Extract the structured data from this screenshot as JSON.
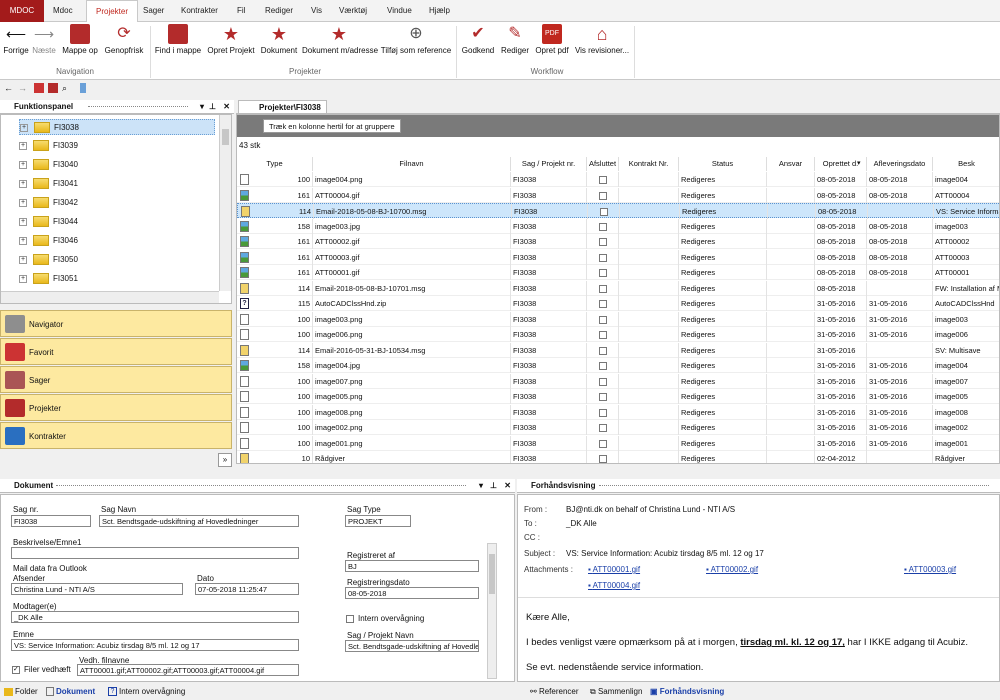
{
  "ribbon_tabs": [
    "MDOC",
    "Mdoc",
    "Projekter",
    "Sager",
    "Kontrakter",
    "Fil",
    "Rediger",
    "Vis",
    "Værktøj",
    "Vindue",
    "Hjælp"
  ],
  "ribbon": {
    "nav": [
      {
        "label": "Forrige",
        "icon": "arrow-left-icon"
      },
      {
        "label": "Næste",
        "icon": "arrow-right-icon"
      },
      {
        "label": "Mappe op",
        "icon": "folder-up-icon"
      },
      {
        "label": "Genopfrisk",
        "icon": "refresh-icon"
      }
    ],
    "nav_group": "Navigation",
    "proj": [
      {
        "label": "Find i mappe"
      },
      {
        "label": "Opret Projekt"
      },
      {
        "label": "Dokument"
      },
      {
        "label": "Dokument m/adresse"
      },
      {
        "label": "Tilføj som reference"
      }
    ],
    "proj_group": "Projekter",
    "wf": [
      {
        "label": "Godkend"
      },
      {
        "label": "Rediger"
      },
      {
        "label": "Opret pdf"
      },
      {
        "label": "Vis revisioner..."
      }
    ],
    "wf_group": "Workflow"
  },
  "panels": {
    "funktion": "Funktionspanel",
    "grid_tab": "Projekter\\FI3038",
    "dokument": "Dokument",
    "preview": "Forhåndsvisning"
  },
  "tree": [
    "FI3038",
    "FI3039",
    "FI3040",
    "FI3041",
    "FI3042",
    "FI3044",
    "FI3046",
    "FI3050",
    "FI3051"
  ],
  "navbuttons": [
    "Navigator",
    "Favorit",
    "Sager",
    "Projekter",
    "Kontrakter"
  ],
  "grid": {
    "group_hint": "Træk en kolonne hertil for at gruppere",
    "count": "43 stk",
    "columns": [
      "Type",
      "Filnavn",
      "Sag / Projekt nr.",
      "Afsluttet",
      "Kontrakt Nr.",
      "Status",
      "Ansvar",
      "Oprettet d.",
      "Afleveringsdato",
      "Besk"
    ],
    "rows": [
      {
        "ic": "doc",
        "n": "100",
        "f": "image004.png",
        "s": "FI3038",
        "st": "Redigeres",
        "o": "08-05-2018",
        "a": "08-05-2018",
        "b": "image004"
      },
      {
        "ic": "img",
        "n": "161",
        "f": "ATT00004.gif",
        "s": "FI3038",
        "st": "Redigeres",
        "o": "08-05-2018",
        "a": "08-05-2018",
        "b": "ATT00004"
      },
      {
        "ic": "msg",
        "n": "114",
        "f": "Email-2018-05-08-BJ-10700.msg",
        "s": "FI3038",
        "st": "Redigeres",
        "o": "08-05-2018",
        "a": "",
        "b": "VS: Service Informa",
        "sel": true
      },
      {
        "ic": "img",
        "n": "158",
        "f": "image003.jpg",
        "s": "FI3038",
        "st": "Redigeres",
        "o": "08-05-2018",
        "a": "08-05-2018",
        "b": "image003"
      },
      {
        "ic": "img",
        "n": "161",
        "f": "ATT00002.gif",
        "s": "FI3038",
        "st": "Redigeres",
        "o": "08-05-2018",
        "a": "08-05-2018",
        "b": "ATT00002"
      },
      {
        "ic": "img",
        "n": "161",
        "f": "ATT00003.gif",
        "s": "FI3038",
        "st": "Redigeres",
        "o": "08-05-2018",
        "a": "08-05-2018",
        "b": "ATT00003"
      },
      {
        "ic": "img",
        "n": "161",
        "f": "ATT00001.gif",
        "s": "FI3038",
        "st": "Redigeres",
        "o": "08-05-2018",
        "a": "08-05-2018",
        "b": "ATT00001"
      },
      {
        "ic": "msg",
        "n": "114",
        "f": "Email-2018-05-08-BJ-10701.msg",
        "s": "FI3038",
        "st": "Redigeres",
        "o": "08-05-2018",
        "a": "",
        "b": "FW: Installation af M"
      },
      {
        "ic": "zip",
        "n": "115",
        "f": "AutoCADClssHnd.zip",
        "s": "FI3038",
        "st": "Redigeres",
        "o": "31-05-2016",
        "a": "31-05-2016",
        "b": "AutoCADClssHnd"
      },
      {
        "ic": "doc",
        "n": "100",
        "f": "image003.png",
        "s": "FI3038",
        "st": "Redigeres",
        "o": "31-05-2016",
        "a": "31-05-2016",
        "b": "image003"
      },
      {
        "ic": "doc",
        "n": "100",
        "f": "image006.png",
        "s": "FI3038",
        "st": "Redigeres",
        "o": "31-05-2016",
        "a": "31-05-2016",
        "b": "image006"
      },
      {
        "ic": "msg",
        "n": "114",
        "f": "Email-2016-05-31-BJ-10534.msg",
        "s": "FI3038",
        "st": "Redigeres",
        "o": "31-05-2016",
        "a": "",
        "b": "SV: Multisave"
      },
      {
        "ic": "img",
        "n": "158",
        "f": "image004.jpg",
        "s": "FI3038",
        "st": "Redigeres",
        "o": "31-05-2016",
        "a": "31-05-2016",
        "b": "image004"
      },
      {
        "ic": "doc",
        "n": "100",
        "f": "image007.png",
        "s": "FI3038",
        "st": "Redigeres",
        "o": "31-05-2016",
        "a": "31-05-2016",
        "b": "image007"
      },
      {
        "ic": "doc",
        "n": "100",
        "f": "image005.png",
        "s": "FI3038",
        "st": "Redigeres",
        "o": "31-05-2016",
        "a": "31-05-2016",
        "b": "image005"
      },
      {
        "ic": "doc",
        "n": "100",
        "f": "image008.png",
        "s": "FI3038",
        "st": "Redigeres",
        "o": "31-05-2016",
        "a": "31-05-2016",
        "b": "image008"
      },
      {
        "ic": "doc",
        "n": "100",
        "f": "image002.png",
        "s": "FI3038",
        "st": "Redigeres",
        "o": "31-05-2016",
        "a": "31-05-2016",
        "b": "image002"
      },
      {
        "ic": "doc",
        "n": "100",
        "f": "image001.png",
        "s": "FI3038",
        "st": "Redigeres",
        "o": "31-05-2016",
        "a": "31-05-2016",
        "b": "image001"
      },
      {
        "ic": "msg",
        "n": "10",
        "f": "Rådgiver",
        "s": "FI3038",
        "st": "Redigeres",
        "o": "02-04-2012",
        "a": "",
        "b": "Rådgiver"
      }
    ]
  },
  "doc": {
    "sagnr_l": "Sag nr.",
    "sagnr": "FI3038",
    "sagnavn_l": "Sag Navn",
    "sagnavn": "Sct. Bendtsgade-udskiftning af Hovedledninger",
    "sagtype_l": "Sag Type",
    "sagtype": "PROJEKT",
    "beskr_l": "Beskrivelse/Emne1",
    "mail_l": "Mail data fra Outlook",
    "afsender_l": "Afsender",
    "afsender": "Christina Lund - NTI A/S",
    "dato_l": "Dato",
    "dato": "07-05-2018 11:25:47",
    "modtager_l": "Modtager(e)",
    "modtager": "_DK Alle",
    "emne_l": "Emne",
    "emne": "VS: Service Information: Acubiz tirsdag 8/5 ml. 12 og 17",
    "filer_l": "Filer vedhæft",
    "vedh_l": "Vedh. filnavne",
    "vedh": "ATT00001.gif;ATT00002.gif;ATT00003.gif;ATT00004.gif",
    "reg_af_l": "Registreret af",
    "reg_af": "BJ",
    "reg_dato_l": "Registreringsdato",
    "reg_dato": "08-05-2018",
    "intern_l": "Intern overvågning",
    "sagproj_l": "Sag / Projekt Navn",
    "sagproj": "Sct. Bendtsgade-udskiftning af Hovedlec",
    "tabs": [
      "Folder",
      "Dokument",
      "Intern overvågning"
    ]
  },
  "preview": {
    "from_l": "From :",
    "from": "BJ@nti.dk on behalf of Christina Lund - NTI A/S",
    "to_l": "To :",
    "to": "_DK Alle",
    "cc_l": "CC :",
    "subject_l": "Subject :",
    "subject": "VS: Service Information: Acubiz tirsdag 8/5 ml. 12 og 17",
    "att_l": "Attachments :",
    "atts": [
      "ATT00001.gif",
      "ATT00002.gif",
      "ATT00003.gif",
      "ATT00004.gif"
    ],
    "body1": "Kære Alle,",
    "body2a": "I bedes venligst være opmærksom på at i morgen, ",
    "body2b": "tirsdag ml. kl. 12 og 17,",
    "body2c": " har I IKKE adgang til Acubiz.",
    "body3": "Se evt. nedenstående service information.",
    "tabs": [
      "Referencer",
      "Sammenlign",
      "Forhåndsvisning"
    ]
  }
}
